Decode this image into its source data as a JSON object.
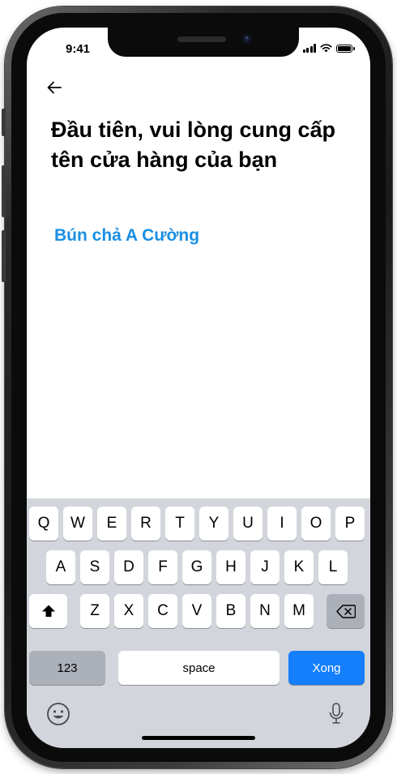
{
  "status_bar": {
    "time": "9:41"
  },
  "header": {
    "back_icon": "arrow-left-icon",
    "title": "Đầu tiên, vui lòng cung cấp tên cửa hàng của bạn"
  },
  "store_name_field": {
    "value": "Bún chả A Cường"
  },
  "keyboard": {
    "row1": [
      "Q",
      "W",
      "E",
      "R",
      "T",
      "Y",
      "U",
      "I",
      "O",
      "P"
    ],
    "row2": [
      "A",
      "S",
      "D",
      "F",
      "G",
      "H",
      "J",
      "K",
      "L"
    ],
    "row3": [
      "Z",
      "X",
      "C",
      "V",
      "B",
      "N",
      "M"
    ],
    "numbers_label": "123",
    "space_label": "space",
    "return_label": "Xong",
    "return_color": "#147efb"
  },
  "colors": {
    "accent_text": "#1a8fe3",
    "keyboard_bg": "#d2d5db"
  }
}
